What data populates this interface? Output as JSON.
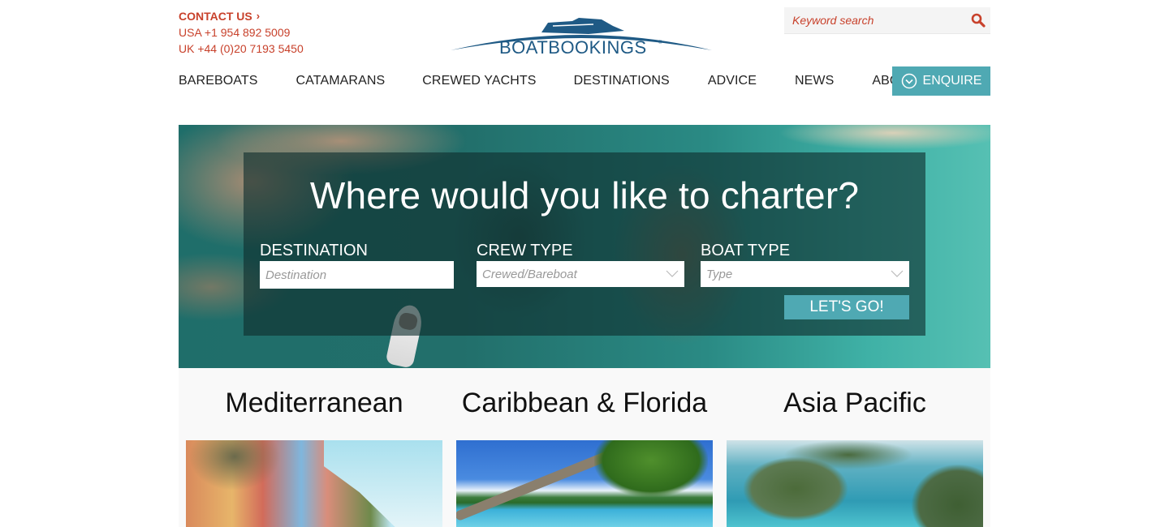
{
  "header": {
    "contact_label": "CONTACT US",
    "contact_chevron": "›",
    "phone_usa": "USA +1 954 892 5009",
    "phone_uk": "UK +44 (0)20 7193 5450",
    "logo_text": "BOATBOOKINGS",
    "logo_mark": "®",
    "search_placeholder": "Keyword search",
    "search_icon": "search-icon"
  },
  "nav": {
    "items": [
      {
        "label": "BAREBOATS"
      },
      {
        "label": "CATAMARANS"
      },
      {
        "label": "CREWED YACHTS"
      },
      {
        "label": "DESTINATIONS"
      },
      {
        "label": "ADVICE"
      },
      {
        "label": "NEWS"
      },
      {
        "label": "ABOUT US"
      }
    ],
    "enquire_label": "ENQUIRE",
    "enquire_icon": "circle-chevron-down-icon"
  },
  "hero": {
    "title": "Where would you like to charter?",
    "destination_label": "DESTINATION",
    "destination_placeholder": "Destination",
    "crew_label": "CREW TYPE",
    "crew_value": "Crewed/Bareboat",
    "boat_label": "BOAT TYPE",
    "boat_value": "Type",
    "submit_label": "LET'S GO!"
  },
  "regions": [
    {
      "title": "Mediterranean"
    },
    {
      "title": "Caribbean & Florida"
    },
    {
      "title": "Asia Pacific"
    }
  ],
  "colors": {
    "accent_red": "#c8412b",
    "accent_teal": "#4fa9b3",
    "logo_blue": "#1f5a85"
  }
}
